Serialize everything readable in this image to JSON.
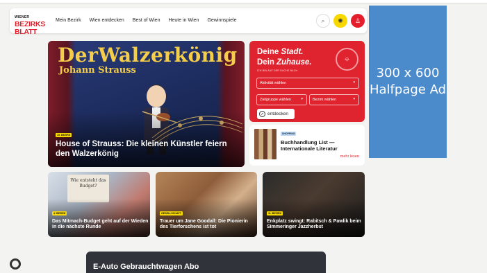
{
  "logo": {
    "line1": "WIENER",
    "line2": "BEZIRKS",
    "line3": "BLATT"
  },
  "nav": [
    "Mein Bezirk",
    "Wien entdecken",
    "Best of Wien",
    "Heute in Wien",
    "Gewinnspiele"
  ],
  "ad": {
    "label": "300 x 600 Halfpage Ad"
  },
  "hero": {
    "art_title": "DerWalzerkönig",
    "art_subtitle": "Johann Strauss",
    "badge": "15. BEZIRK",
    "title": "House of Strauss: Die kleinen Künstler feiern den Walzerkönig"
  },
  "widget": {
    "line1": "Deine",
    "line1_italic": "Stadt.",
    "line2": "Dein",
    "line2_italic": "Zuhause.",
    "caption": "ICH BIN AUF DER SUCHE NACH",
    "select_activity": "Aktivität wählen",
    "select_group": "Zielgruppe wählen",
    "select_district": "Bezirk wählen",
    "button": "entdecken"
  },
  "shopping": {
    "badge": "SHOPPING",
    "title": "Buchhandlung List — Internationale Literatur",
    "more": "mehr lesen"
  },
  "cards": [
    {
      "badge": "4. BEZIRK",
      "title": "Das Mitmach-Budget geht auf der Wieden in die nächste Runde",
      "sign": "Wie entsteht das Budget?"
    },
    {
      "badge": "GESELLSCHAFT",
      "title": "Trauer um Jane Goodall: Die Pionierin des Tierforschens ist tot"
    },
    {
      "badge": "11. BEZIRK",
      "title": "Enkplatz swingt: Rabitsch & Pawlik beim Simmeringer Jazzherbst"
    }
  ],
  "promo": {
    "title": "E-Auto Gebrauchtwagen Abo"
  },
  "colors": {
    "brand": "#e41e2b",
    "ad": "#4b8bcc",
    "badge": "#f7d900"
  }
}
